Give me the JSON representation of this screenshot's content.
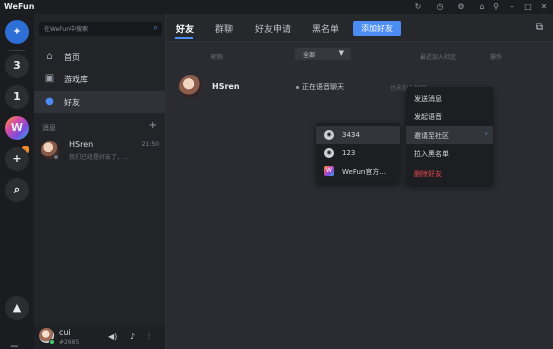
{
  "app": {
    "name": "WeFun"
  },
  "titlebar_icons": [
    "history-icon",
    "clock-icon",
    "settings-icon",
    "shirt-icon",
    "pin-icon",
    "minimize-icon",
    "maximize-icon",
    "close-icon"
  ],
  "rail": {
    "items": [
      {
        "label": "",
        "icon": "wefun-logo-icon"
      },
      {
        "label": "3"
      },
      {
        "label": "1"
      },
      {
        "label": "W"
      },
      {
        "label": "+"
      },
      {
        "label": "⌕"
      },
      {
        "label": "▲"
      }
    ]
  },
  "sidebar": {
    "search_placeholder": "在WeFun中搜索",
    "nav": [
      {
        "label": "首页",
        "icon": "home-icon"
      },
      {
        "label": "游戏库",
        "icon": "gamepad-icon"
      },
      {
        "label": "好友",
        "icon": "user-icon",
        "active": true
      }
    ],
    "messages_title": "消息",
    "messages": [
      {
        "name": "HSren",
        "time": "21:50",
        "preview": "我们已经是好友了，..."
      }
    ],
    "user": {
      "name": "cui",
      "id": "#2685"
    }
  },
  "tabs": [
    {
      "label": "好友",
      "active": true
    },
    {
      "label": "群聊"
    },
    {
      "label": "好友申请"
    },
    {
      "label": "黑名单"
    }
  ],
  "add_friend_label": "添加好友",
  "table": {
    "headers": {
      "nickname": "昵称",
      "recent_community": "最近加入社区",
      "actions": "操作"
    },
    "filter_label": "全部",
    "rows": [
      {
        "name": "HSren",
        "status": "正在语音聊天",
        "recent": "也未加入社区"
      }
    ]
  },
  "context_menu": {
    "items": [
      {
        "label": "发送消息"
      },
      {
        "label": "发起语音"
      },
      {
        "label": "邀请至社区",
        "has_submenu": true,
        "hover": true
      },
      {
        "label": "拉入黑名单"
      },
      {
        "label": "删除好友",
        "danger": true
      }
    ]
  },
  "submenu": {
    "items": [
      {
        "label": "3434",
        "icon": "community-icon",
        "hover": true
      },
      {
        "label": "123",
        "icon": "community-icon"
      },
      {
        "label": "WeFun官方...",
        "icon": "wefun-community-icon"
      }
    ]
  },
  "colors": {
    "accent": "#4b8cf5",
    "danger": "#e5484d",
    "background": "#26282c"
  }
}
